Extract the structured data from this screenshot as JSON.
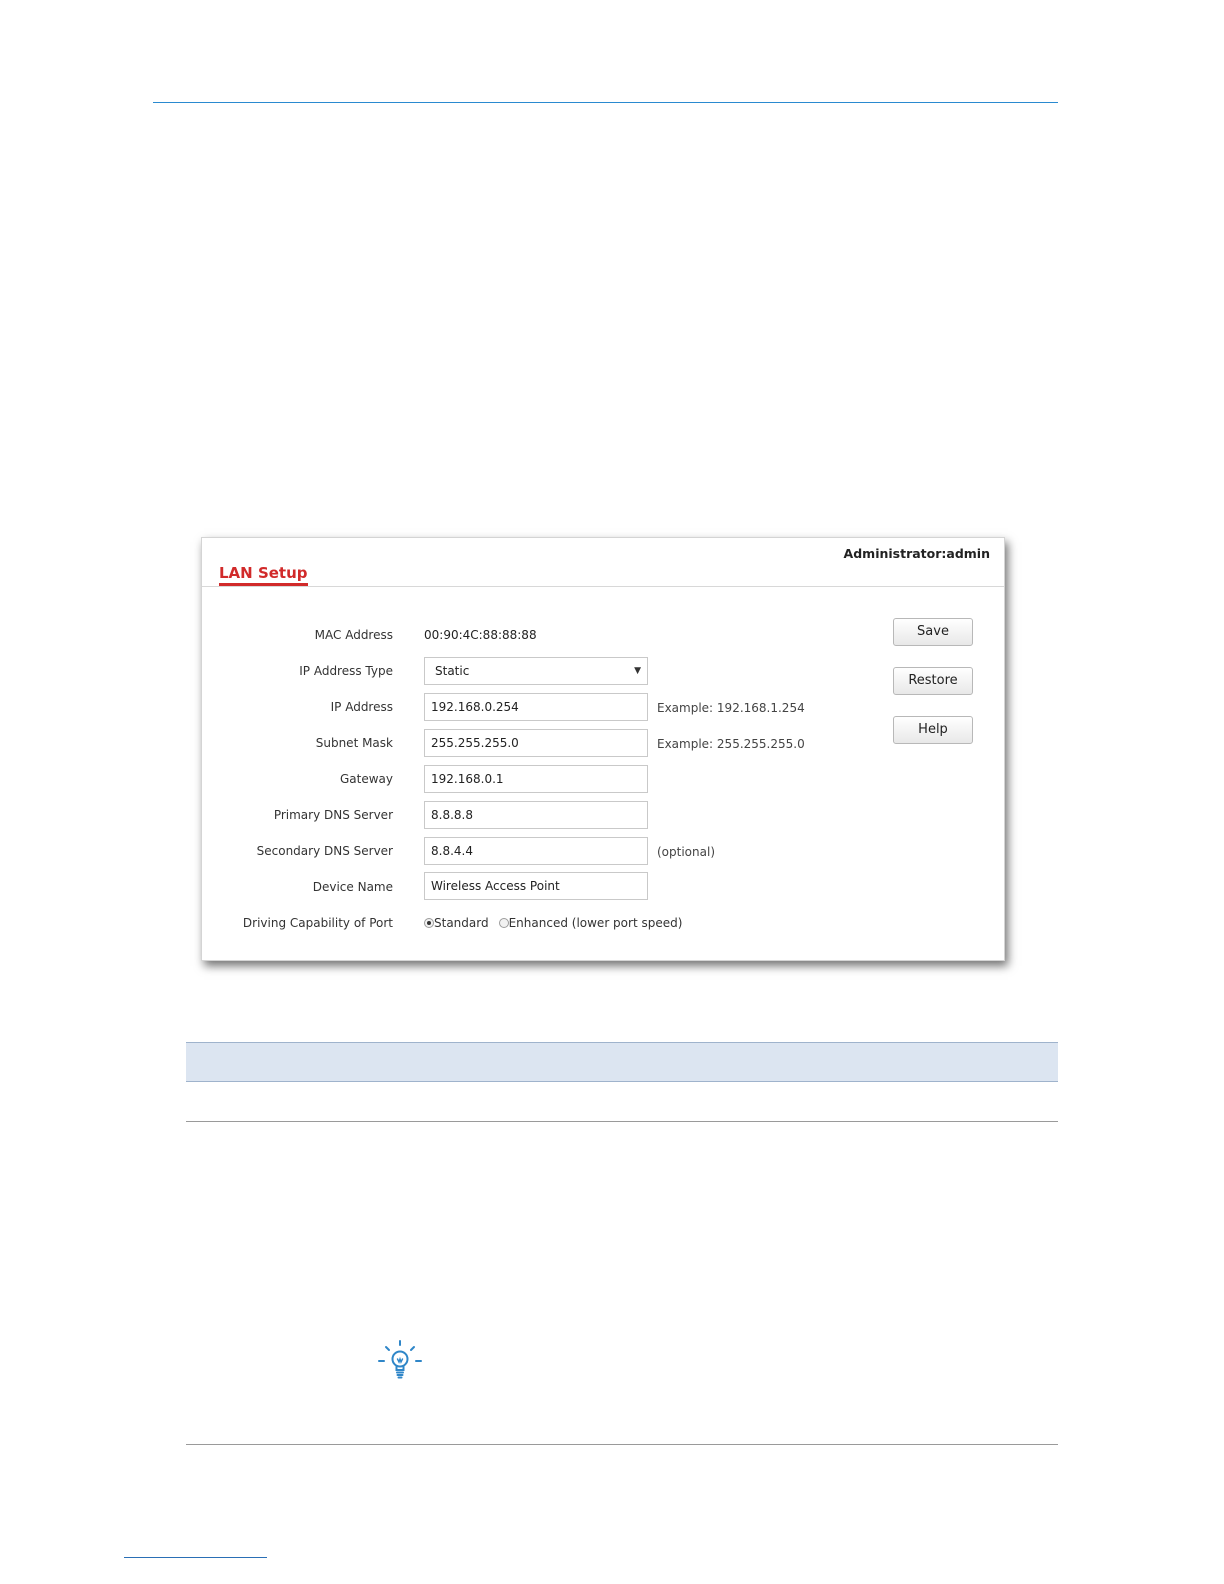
{
  "panel": {
    "title": "LAN Setup",
    "administrator": "Administrator:admin"
  },
  "form": {
    "mac_label": "MAC Address",
    "mac_value": "00:90:4C:88:88:88",
    "ip_type_label": "IP Address Type",
    "ip_type_value": "Static",
    "ip_label": "IP Address",
    "ip_value": "192.168.0.254",
    "ip_hint": "Example: 192.168.1.254",
    "mask_label": "Subnet Mask",
    "mask_value": "255.255.255.0",
    "mask_hint": "Example: 255.255.255.0",
    "gateway_label": "Gateway",
    "gateway_value": "192.168.0.1",
    "dns1_label": "Primary DNS Server",
    "dns1_value": "8.8.8.8",
    "dns2_label": "Secondary DNS Server",
    "dns2_value": "8.8.4.4",
    "dns2_hint": "(optional)",
    "device_label": "Device Name",
    "device_value": "Wireless Access Point",
    "drive_label": "Driving Capability of Port",
    "drive_options": {
      "standard": "Standard",
      "enhanced": "Enhanced (lower port speed)"
    },
    "drive_selected": "Standard"
  },
  "buttons": {
    "save": "Save",
    "restore": "Restore",
    "help": "Help"
  },
  "icons": {
    "tip": "lightbulb-icon",
    "select_arrow": "chevron-down-icon"
  },
  "colors": {
    "accent_rule": "#2a8ad0",
    "title_red": "#d12a2a",
    "table_header": "#dce5f1"
  }
}
